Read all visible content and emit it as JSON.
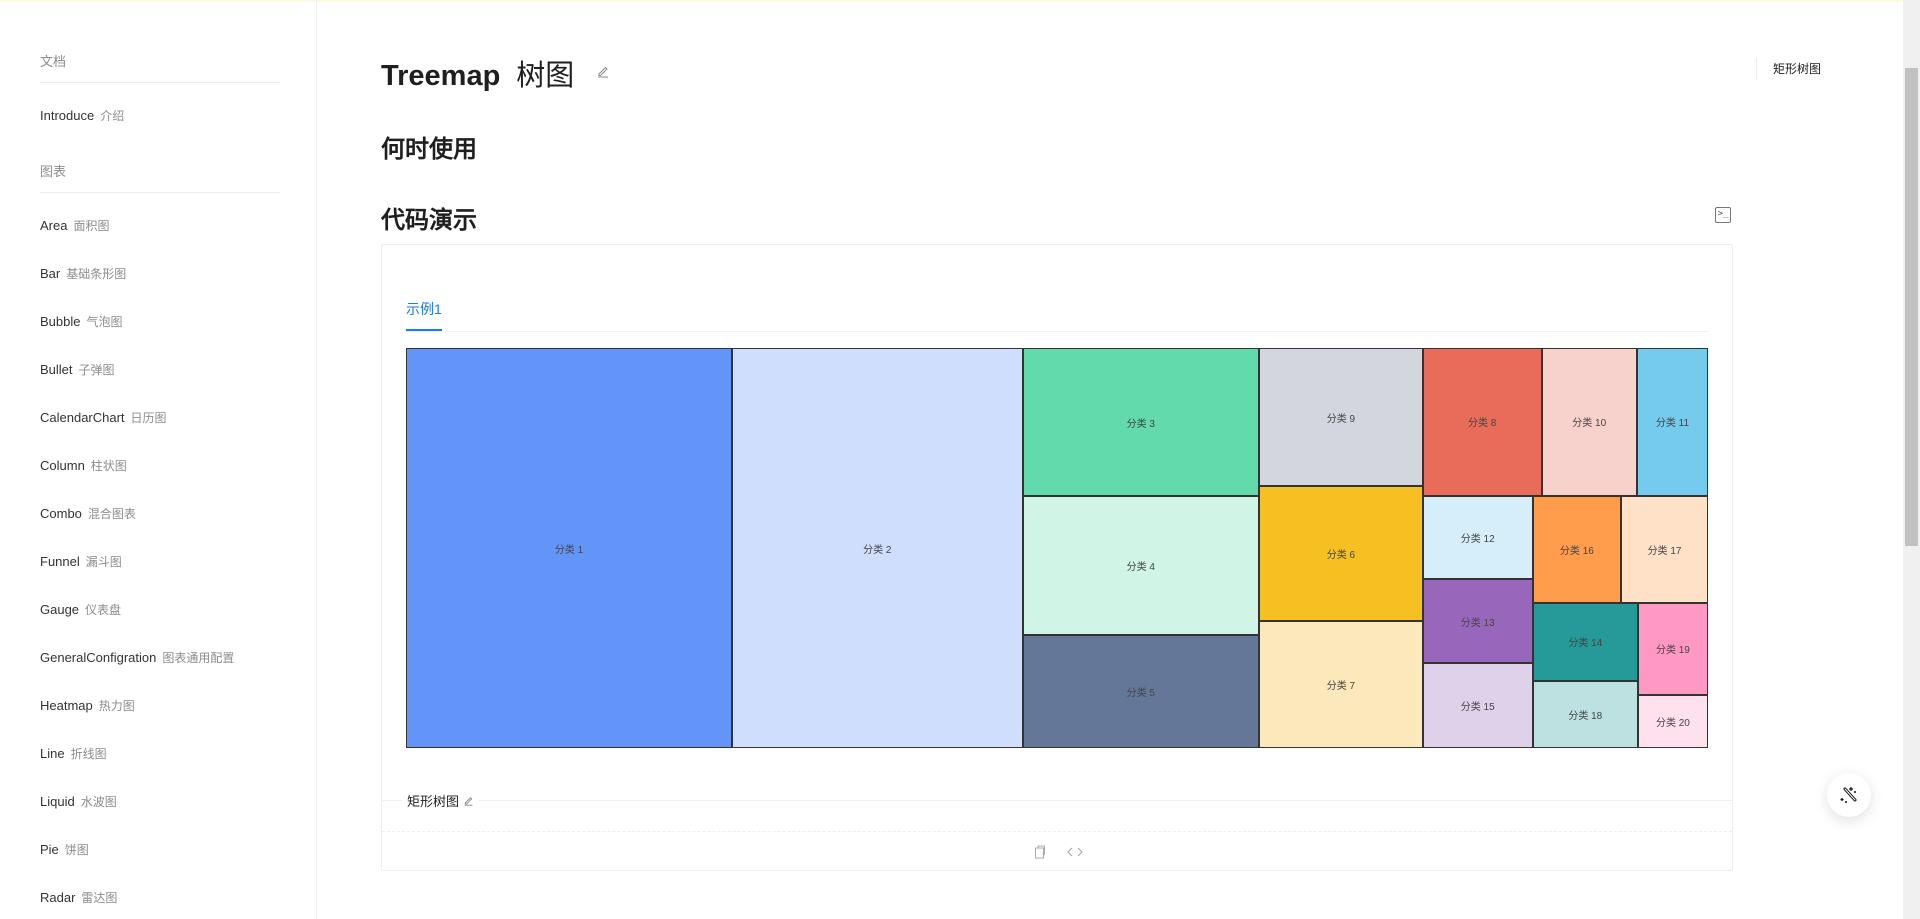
{
  "sidebar": {
    "group_docs": "文档",
    "intro": {
      "en": "Introduce",
      "zh": "介绍"
    },
    "group_charts": "图表",
    "items": [
      {
        "en": "Area",
        "zh": "面积图"
      },
      {
        "en": "Bar",
        "zh": "基础条形图"
      },
      {
        "en": "Bubble",
        "zh": "气泡图"
      },
      {
        "en": "Bullet",
        "zh": "子弹图"
      },
      {
        "en": "CalendarChart",
        "zh": "日历图"
      },
      {
        "en": "Column",
        "zh": "柱状图"
      },
      {
        "en": "Combo",
        "zh": "混合图表"
      },
      {
        "en": "Funnel",
        "zh": "漏斗图"
      },
      {
        "en": "Gauge",
        "zh": "仪表盘"
      },
      {
        "en": "GeneralConfigration",
        "zh": "图表通用配置"
      },
      {
        "en": "Heatmap",
        "zh": "热力图"
      },
      {
        "en": "Line",
        "zh": "折线图"
      },
      {
        "en": "Liquid",
        "zh": "水波图"
      },
      {
        "en": "Pie",
        "zh": "饼图"
      },
      {
        "en": "Radar",
        "zh": "雷达图"
      }
    ]
  },
  "page": {
    "title_en": "Treemap",
    "title_zh": "树图",
    "when_to_use": "何时使用",
    "code_demo": "代码演示"
  },
  "demo": {
    "tab": "示例1",
    "meta_title": "矩形树图"
  },
  "toc": {
    "items": [
      "矩形树图"
    ]
  },
  "chart_data": {
    "type": "treemap",
    "categories": [
      "分类 1",
      "分类 2",
      "分类 3",
      "分类 4",
      "分类 5",
      "分类 6",
      "分类 7",
      "分类 8",
      "分类 9",
      "分类 10",
      "分类 11",
      "分类 12",
      "分类 13",
      "分类 14",
      "分类 15",
      "分类 16",
      "分类 17",
      "分类 18",
      "分类 19",
      "分类 20"
    ],
    "values": [
      870,
      775,
      234,
      218,
      179,
      147,
      139,
      117,
      151,
      94,
      70,
      61,
      62,
      55,
      62,
      63,
      62,
      47,
      43,
      25
    ],
    "colors": [
      "#6395f9",
      "#cfdefc",
      "#62daab",
      "#d0f4e6",
      "#657798",
      "#f6c022",
      "#fbe9bb",
      "#e96c5b",
      "#d3d6df",
      "#f7d2cc",
      "#74cbed",
      "#d5eef9",
      "#9867bc",
      "#269a99",
      "#e0d1ea",
      "#ff9d4d",
      "#ffe1c8",
      "#bde1e0",
      "#ff99c3",
      "#ffe0ed"
    ]
  }
}
